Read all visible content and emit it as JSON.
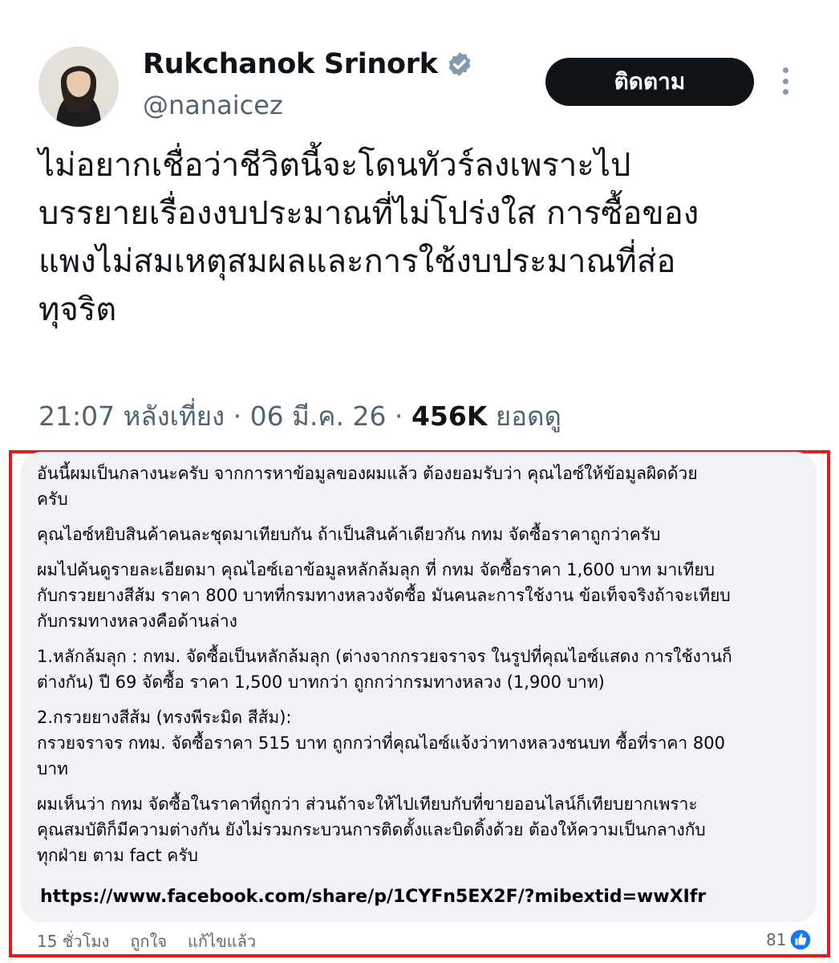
{
  "tweet": {
    "author_name": "Rukchanok Srinork",
    "handle": "@nanaicez",
    "follow_label": "ติดตาม",
    "text_lines": [
      "ไม่อยากเชื่อว่าชีวิตนี้จะโดนทัวร์ลงเพราะไป",
      "บรรยายเรื่องงบประมาณที่ไม่โปร่งใส การซื้อของ",
      "แพงไม่สมเหตุสมผลและการใช้งบประมาณที่ส่อ",
      "ทุจริต"
    ],
    "time": "21:07 หลังเที่ยง",
    "date": "06 มี.ค. 26",
    "views_count": "456K",
    "views_label": "ยอดดู",
    "separator": "·"
  },
  "comment": {
    "lines": [
      "อันนี้ผมเป็นกลางนะครับ จากการหาข้อมูลของผมแล้ว ต้องยอมรับว่า คุณไอซ์ให้ข้อมูลผิดด้วย",
      "ครับ",
      "คุณไอซ์หยิบสินค้าคนละชุดมาเทียบกัน ถ้าเป็นสินค้าเดียวกัน กทม จัดซื้อราคาถูกว่าครับ",
      "ผมไปค้นดูรายละเอียดมา คุณไอซ์เอาข้อมูลหลักล้มลุก ที่ กทม จัดซื้อราคา 1,600 บาท มาเทียบ",
      "กับกรวยยางสีส้ม ราคา 800 บาทที่กรมทางหลวงจัดซื้อ มันคนละการใช้งาน ข้อเท็จจริงถ้าจะเทียบ",
      "กับกรมทางหลวงคือด้านล่าง",
      "1.หลักล้มลุก : กทม. จัดซื้อเป็นหลักล้มลุก (ต่างจากกรวยจราจร ในรูปที่คุณไอซ์แสดง การใช้งานก็",
      "ต่างกัน) ปี 69 จัดซื้อ ราคา 1,500 บาทกว่า ถูกกว่ากรมทางหลวง (1,900 บาท)",
      "2.กรวยยางสีส้ม (ทรงพีระมิด สีส้ม):",
      "กรวยจราจร กทม. จัดซื้อราคา 515 บาท ถูกกว่าที่คุณไอซ์แจ้งว่าทางหลวงชนบท ซื้อที่ราคา 800",
      "บาท",
      "ผมเห็นว่า กทม จัดซื้อในราคาที่ถูกว่า ส่วนถ้าจะให้ไปเทียบกับที่ขายออนไลน์ก็เทียบยากเพราะ",
      "คุณสมบัติก็มีความต่างกัน ยังไม่รวมกระบวนการติดตั้งและบิดดิ้งด้วย ต้องให้ความเป็นกลางกับ",
      "ทุกฝ่าย ตาม fact ครับ"
    ],
    "link": "https://www.facebook.com/share/p/1CYFn5EX2F/?mibextid=wwXIfr",
    "time_ago": "15 ชั่วโมง",
    "like_label": "ถูกใจ",
    "edited_label": "แก้ไขแล้ว",
    "like_count": "81"
  },
  "colors": {
    "follow_button": "#0f1419",
    "verified_badge": "#829aab",
    "highlight_border": "#e31b1b",
    "comment_bubble": "#f0f2f5",
    "like_badge": "#1877f2"
  },
  "icons": {
    "verified": "verified-badge-icon",
    "more": "more-options-icon",
    "like": "like-thumb-icon"
  }
}
